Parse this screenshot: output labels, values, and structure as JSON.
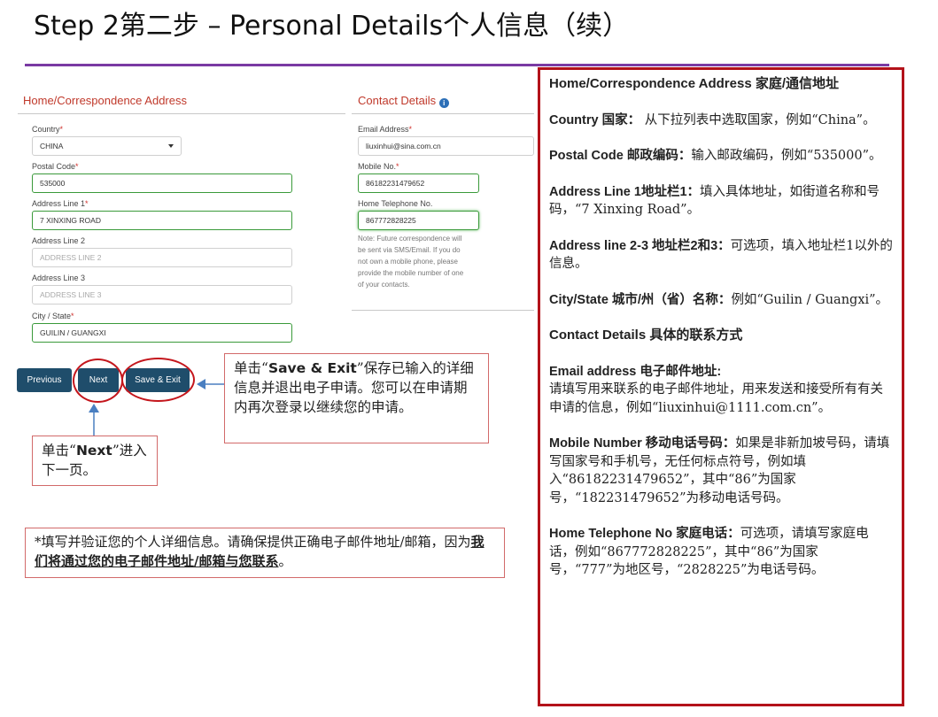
{
  "slide": {
    "title": "Step 2第二步 – Personal Details个人信息（续）"
  },
  "form": {
    "address_section": {
      "title": "Home/Correspondence Address",
      "country": {
        "label": "Country",
        "value": "CHINA"
      },
      "postal_code": {
        "label": "Postal Code",
        "value": "535000"
      },
      "address_line_1": {
        "label": "Address Line 1",
        "value": "7 XINXING ROAD"
      },
      "address_line_2": {
        "label": "Address Line 2",
        "placeholder": "ADDRESS LINE 2"
      },
      "address_line_3": {
        "label": "Address Line 3",
        "placeholder": "ADDRESS LINE 3"
      },
      "city_state": {
        "label": "City / State",
        "value": "GUILIN / GUANGXI"
      }
    },
    "contact_section": {
      "title": "Contact Details",
      "email": {
        "label": "Email Address",
        "value": "liuxinhui@sina.com.cn"
      },
      "mobile": {
        "label": "Mobile No.",
        "value": "86182231479652"
      },
      "home_phone": {
        "label": "Home Telephone No.",
        "value": "867772828225"
      },
      "note_lines": [
        "Note: Future correspondence will",
        "be sent via SMS/Email. If you do",
        "not own a mobile phone, please",
        "provide the mobile number of one",
        "of your contacts."
      ]
    },
    "buttons": {
      "previous": "Previous",
      "next": "Next",
      "save_exit": "Save & Exit"
    }
  },
  "callouts": {
    "save_exit": {
      "pre": "单击“",
      "bold": "Save & Exit",
      "post": "”保存已输入的详细信息并退出电子申请。您可以在申请期内再次登录以继续您的申请。"
    },
    "next": {
      "pre": "单击“",
      "bold": "Next",
      "post": "”进入下一页。"
    },
    "verify": {
      "pre": "*填写并验证您的个人详细信息。请确保提供正确电子邮件地址/邮箱，因为",
      "underline": "我们将通过您的电子邮件地址/邮箱与您联系",
      "post": "。"
    }
  },
  "right_panel": {
    "heading": "Home/Correspondence Address 家庭/通信地址",
    "items": [
      {
        "term": "Country 国家：",
        "desc": " 从下拉列表中选取国家，例如“China”。"
      },
      {
        "term": "Postal Code 邮政编码：",
        "desc": "输入邮政编码，例如“535000”。"
      },
      {
        "term": "Address Line 1地址栏1：",
        "desc": "填入具体地址，如街道名称和号码，“7 Xinxing Road”。"
      },
      {
        "term": "Address line 2-3 地址栏2和3：",
        "desc": "可选项，填入地址栏1以外的信息。"
      },
      {
        "term": "City/State 城市/州（省）名称：",
        "desc": "例如“Guilin / Guangxi”。"
      }
    ],
    "contact_heading": "Contact Details 具体的联系方式",
    "contact_items": [
      {
        "term": "Email address 电子邮件地址:",
        "desc": "请填写用来联系的电子邮件地址，用来发送和接受所有有关申请的信息，例如“liuxinhui@1111.com.cn”。"
      },
      {
        "term": "Mobile Number 移动电话号码：",
        "desc": "如果是非新加坡号码，请填写国家号和手机号，无任何标点符号，例如填入“86182231479652”，其中“86”为国家号，“182231479652”为移动电话号码。"
      },
      {
        "term": "Home Telephone No 家庭电话：",
        "desc": "可选项，请填写家庭电话，例如“867772828225”，其中“86”为国家号，“777”为地区号，“2828225”为电话号码。"
      }
    ]
  },
  "colors": {
    "accent_line": "#7a3aa3",
    "panel_border": "#b3121a",
    "button": "#1f4d6b",
    "section_title": "#c0392b"
  }
}
